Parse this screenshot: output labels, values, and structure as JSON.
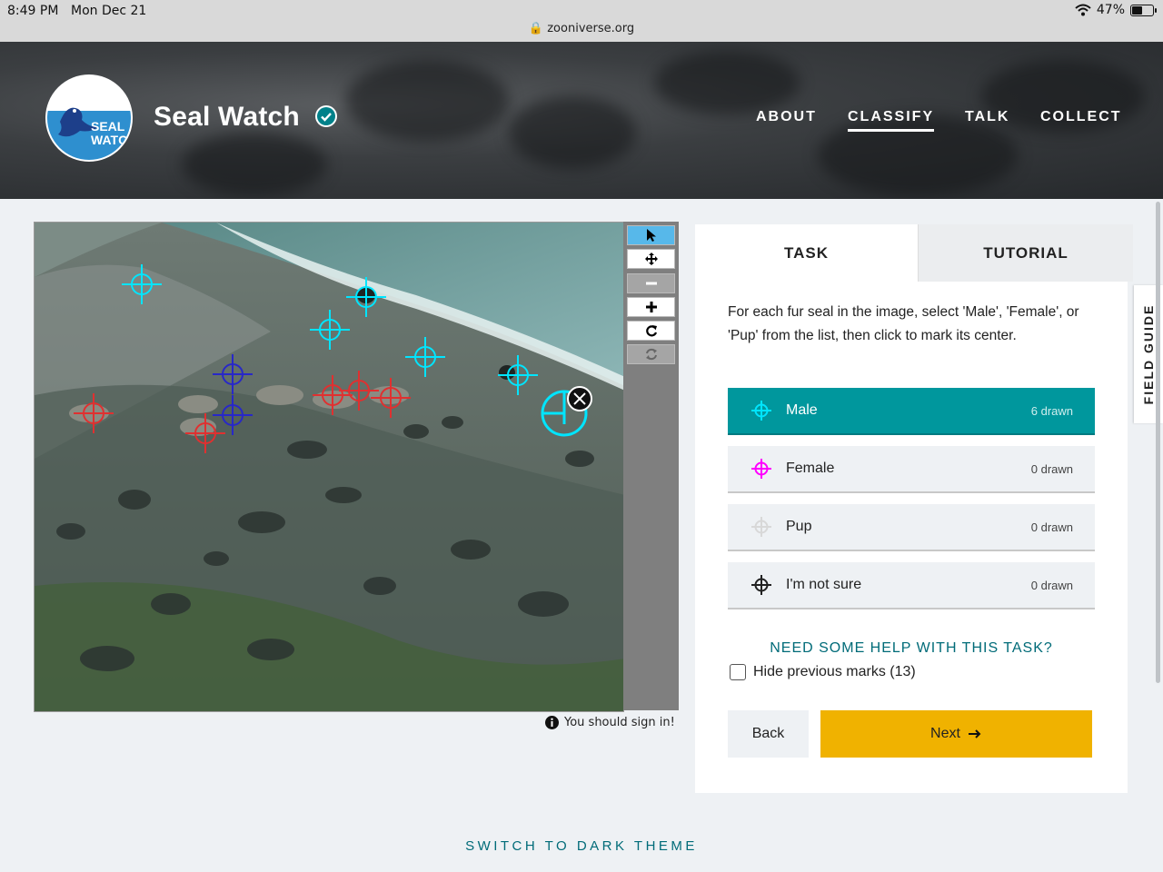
{
  "status_bar": {
    "time": "8:49 PM",
    "date": "Mon Dec 21",
    "url": "zooniverse.org",
    "battery": "47%"
  },
  "header": {
    "project_name": "Seal Watch",
    "logo_text": "SEAL\nWATCH",
    "nav": [
      {
        "label": "ABOUT",
        "active": false
      },
      {
        "label": "CLASSIFY",
        "active": true
      },
      {
        "label": "TALK",
        "active": false
      },
      {
        "label": "COLLECT",
        "active": false
      }
    ]
  },
  "viewer": {
    "signin_notice": "You should sign in!",
    "tools": [
      "pointer",
      "move",
      "zoom-out",
      "zoom-in",
      "reset",
      "rotate"
    ]
  },
  "panel": {
    "tabs": {
      "task": "TASK",
      "tutorial": "TUTORIAL"
    },
    "instructions": "For each fur seal in the image, select 'Male', 'Female', or 'Pup' from the list, then click to mark its center.",
    "options": [
      {
        "label": "Male",
        "count": "6 drawn",
        "color": "#00e5ff",
        "selected": true
      },
      {
        "label": "Female",
        "count": "0 drawn",
        "color": "#ff00ff",
        "selected": false
      },
      {
        "label": "Pup",
        "count": "0 drawn",
        "color": "#d8d8d8",
        "selected": false
      },
      {
        "label": "I'm not sure",
        "count": "0 drawn",
        "color": "#222222",
        "selected": false
      }
    ],
    "help_link": "NEED SOME HELP WITH THIS TASK?",
    "hide_marks": "Hide previous marks (13)",
    "back": "Back",
    "next": "Next"
  },
  "field_guide": "FIELD GUIDE",
  "footer": {
    "theme_toggle": "SWITCH TO DARK THEME"
  },
  "colors": {
    "accent": "#00979d",
    "next_button": "#f0b200",
    "link": "#006b78",
    "mark_male": "#00e5ff",
    "mark_red": "#e03030",
    "mark_blue": "#2020c0"
  }
}
